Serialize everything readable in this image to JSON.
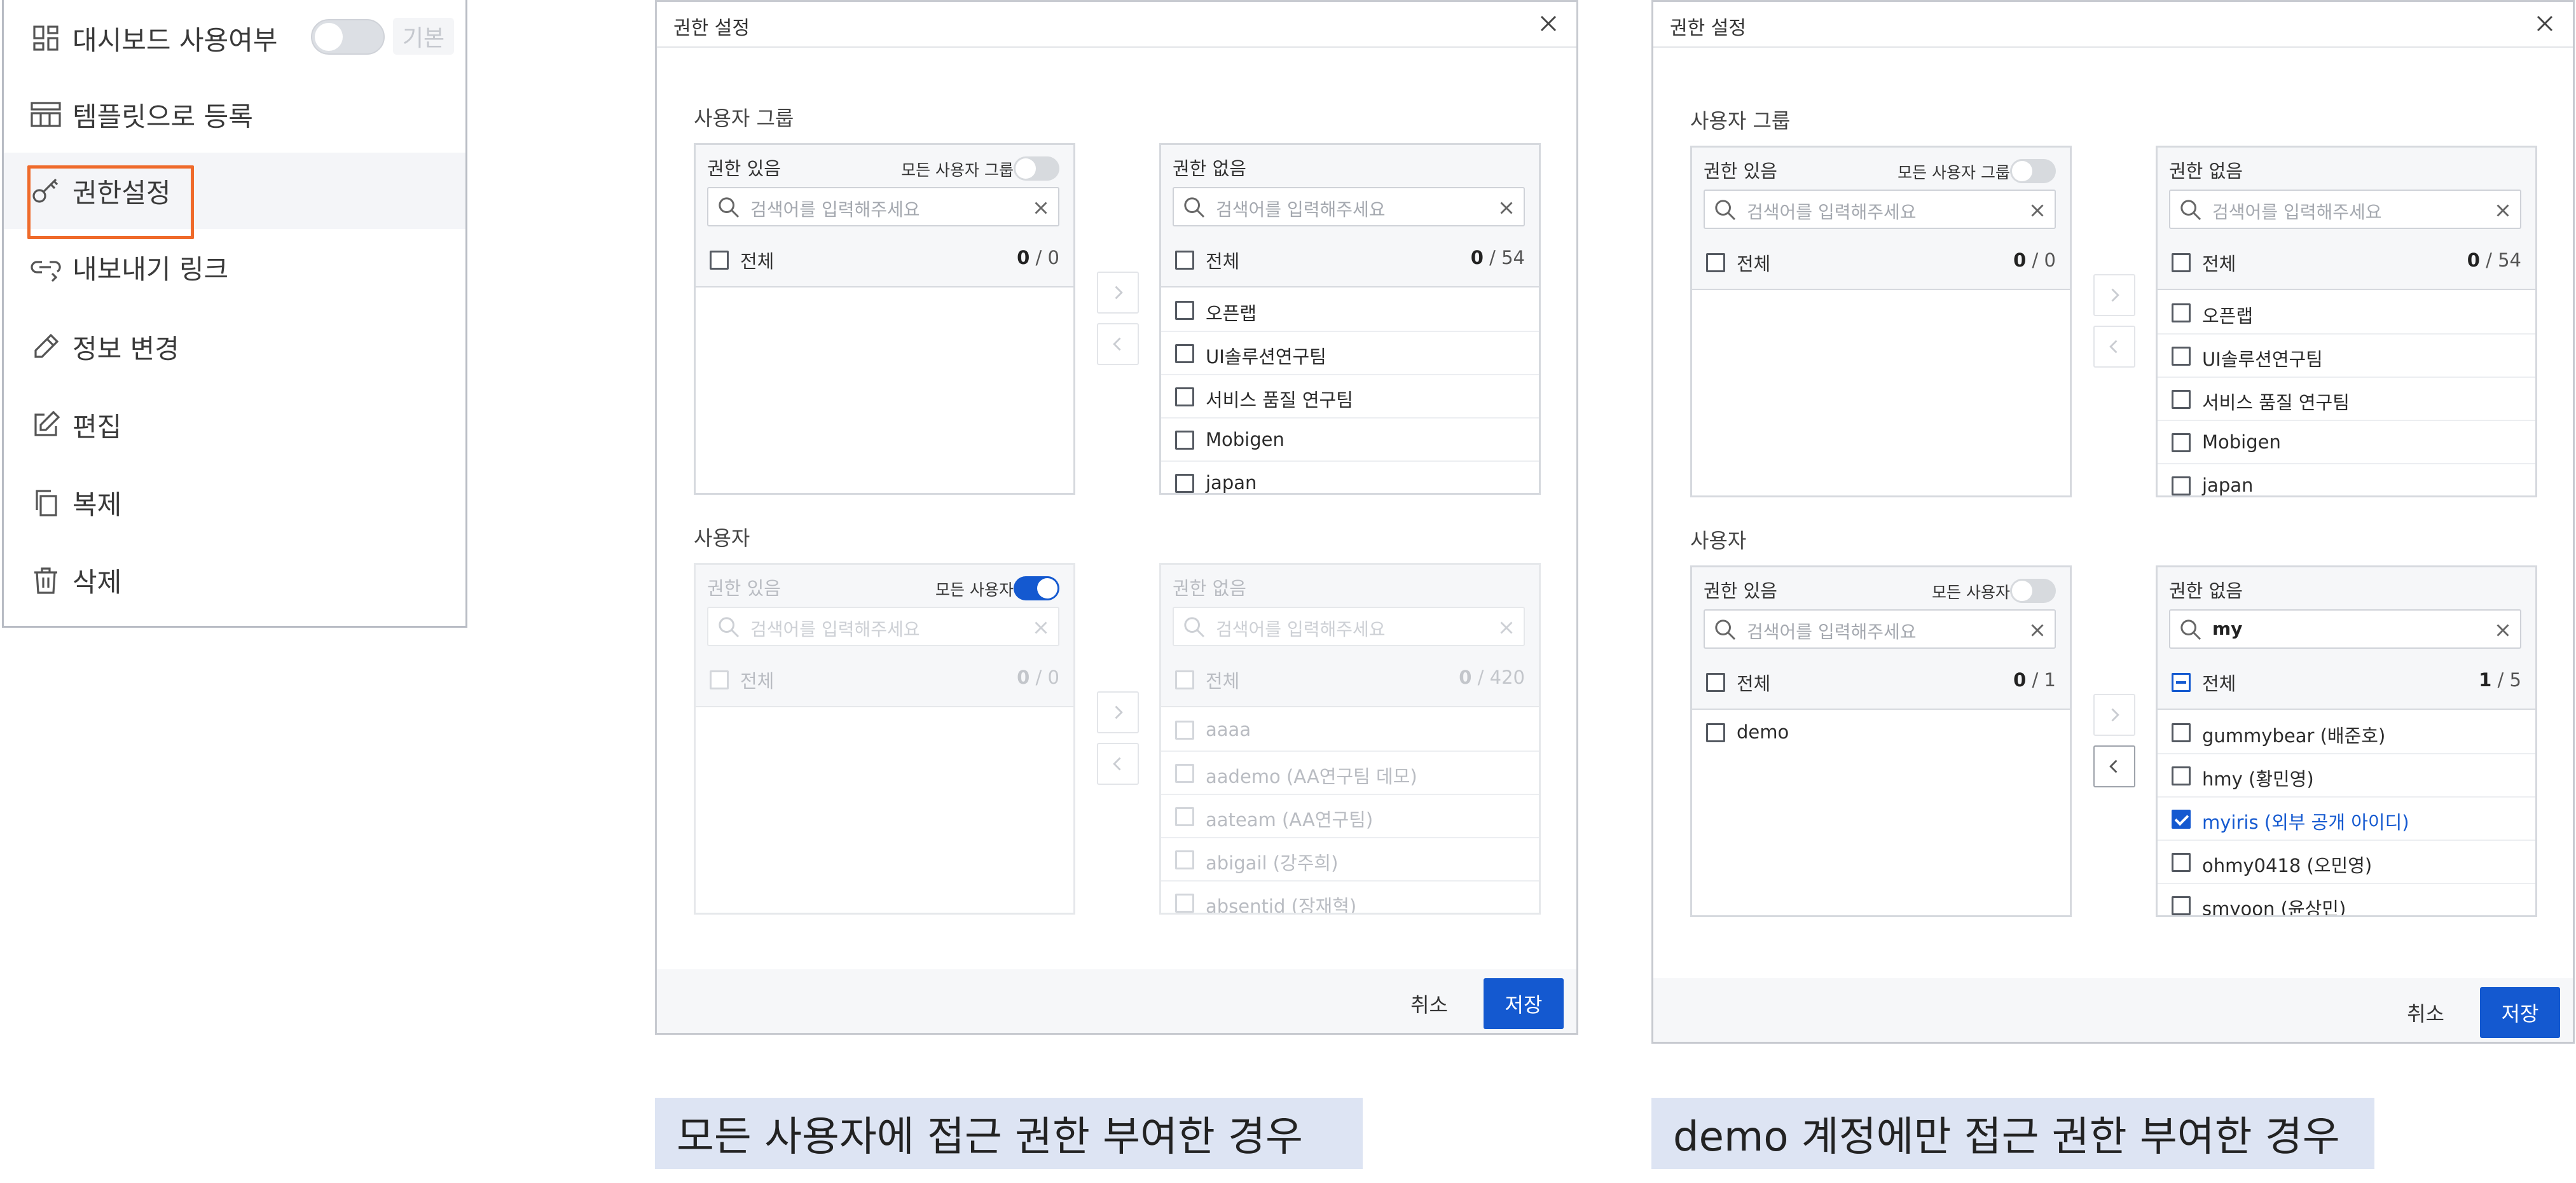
{
  "menu": {
    "items": [
      {
        "label": "대시보드 사용여부",
        "icon": "dashboard-icon"
      },
      {
        "label": "템플릿으로 등록",
        "icon": "template-icon"
      },
      {
        "label": "권한설정",
        "icon": "key-icon"
      },
      {
        "label": "내보내기 링크",
        "icon": "link-icon"
      },
      {
        "label": "정보 변경",
        "icon": "pencil-icon"
      },
      {
        "label": "편집",
        "icon": "edit-icon"
      },
      {
        "label": "복제",
        "icon": "copy-icon"
      },
      {
        "label": "삭제",
        "icon": "trash-icon"
      }
    ],
    "dashboard_toggle_on": false,
    "badge": "기본",
    "highlight_color": "#ef6a2a"
  },
  "dialogs": [
    {
      "title": "권한 설정",
      "group_section": "사용자 그룹",
      "user_section": "사용자",
      "cancel": "취소",
      "save": "저장",
      "group_allowed": {
        "label": "권한 있음",
        "toggle_label": "모든 사용자 그룹",
        "toggle_on": false,
        "search_placeholder": "검색어를 입력해주세요",
        "search_value": "",
        "all_label": "전체",
        "count_selected": "0",
        "count_total": " / 0",
        "items": []
      },
      "group_denied": {
        "label": "권한 없음",
        "search_placeholder": "검색어를 입력해주세요",
        "search_value": "",
        "all_label": "전체",
        "count_selected": "0",
        "count_total": " / 54",
        "items": [
          "오픈랩",
          "UI솔루션연구팀",
          "서비스 품질 연구팀",
          "Mobigen",
          "japan"
        ]
      },
      "user_allowed": {
        "label": "권한 있음",
        "toggle_label": "모든 사용자",
        "toggle_on": true,
        "search_placeholder": "검색어를 입력해주세요",
        "search_value": "",
        "all_label": "전체",
        "count_selected": "0",
        "count_total": " / 0",
        "items": []
      },
      "user_denied": {
        "label": "권한 없음",
        "search_placeholder": "검색어를 입력해주세요",
        "search_value": "",
        "all_label": "전체",
        "count_selected": "0",
        "count_total": " / 420",
        "items": [
          "aaaa",
          "aademo (AA연구팀 데모)",
          "aateam (AA연구팀)",
          "abigail (강주희)",
          "absentid (장재혁)"
        ]
      },
      "caption": "모든 사용자에 접근 권한 부여한 경우"
    },
    {
      "title": "권한 설정",
      "group_section": "사용자 그룹",
      "user_section": "사용자",
      "cancel": "취소",
      "save": "저장",
      "group_allowed": {
        "label": "권한 있음",
        "toggle_label": "모든 사용자 그룹",
        "toggle_on": false,
        "search_placeholder": "검색어를 입력해주세요",
        "search_value": "",
        "all_label": "전체",
        "count_selected": "0",
        "count_total": " / 0",
        "items": []
      },
      "group_denied": {
        "label": "권한 없음",
        "search_placeholder": "검색어를 입력해주세요",
        "search_value": "",
        "all_label": "전체",
        "count_selected": "0",
        "count_total": " / 54",
        "items": [
          "오픈랩",
          "UI솔루션연구팀",
          "서비스 품질 연구팀",
          "Mobigen",
          "japan"
        ]
      },
      "user_allowed": {
        "label": "권한 있음",
        "toggle_label": "모든 사용자",
        "toggle_on": false,
        "search_placeholder": "검색어를 입력해주세요",
        "search_value": "",
        "all_label": "전체",
        "count_selected": "0",
        "count_total": " / 1",
        "items": [
          "demo"
        ]
      },
      "user_denied": {
        "label": "권한 없음",
        "search_placeholder": "검색어를 입력해주세요",
        "search_value": "my",
        "all_label": "전체",
        "count_selected": "1",
        "count_total": " / 5",
        "items": [
          "gummybear (배준호)",
          "hmy (황민영)",
          "myiris (외부 공개 아이디)",
          "ohmy0418 (오민영)",
          "smyoon (윤상민)"
        ],
        "selected_item": "myiris (외부 공개 아이디)"
      },
      "caption": "demo 계정에만 접근 권한 부여한 경우"
    }
  ],
  "colors": {
    "primary": "#1459d0",
    "caption_bg": "#dde4f3"
  }
}
